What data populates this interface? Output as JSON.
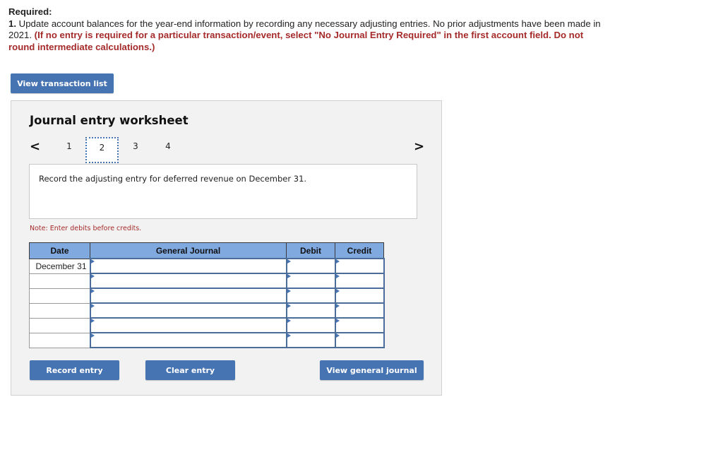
{
  "instructions": {
    "heading": "Required:",
    "item_number": "1.",
    "text": " Update account balances for the year-end information by recording any necessary adjusting entries. No prior adjustments have been made in 2021. ",
    "red_text": "(If no entry is required for a particular transaction/event, select \"No Journal Entry Required\" in the first account field. Do not round intermediate calculations.)"
  },
  "buttons": {
    "view_transactions": "View transaction list",
    "record_entry": "Record entry",
    "clear_entry": "Clear entry",
    "view_general_journal": "View general journal"
  },
  "worksheet": {
    "title": "Journal entry worksheet",
    "prev_icon": "<",
    "next_icon": ">",
    "pages": [
      "1",
      "2",
      "3",
      "4"
    ],
    "active_page": "2",
    "description": "Record the adjusting entry for deferred revenue on December 31.",
    "note": "Note: Enter debits before credits."
  },
  "table": {
    "headers": [
      "Date",
      "General Journal",
      "Debit",
      "Credit"
    ],
    "rows": [
      {
        "date": "December 31",
        "account": "",
        "debit": "",
        "credit": ""
      },
      {
        "date": "",
        "account": "",
        "debit": "",
        "credit": ""
      },
      {
        "date": "",
        "account": "",
        "debit": "",
        "credit": ""
      },
      {
        "date": "",
        "account": "",
        "debit": "",
        "credit": ""
      },
      {
        "date": "",
        "account": "",
        "debit": "",
        "credit": ""
      },
      {
        "date": "",
        "account": "",
        "debit": "",
        "credit": ""
      }
    ]
  }
}
